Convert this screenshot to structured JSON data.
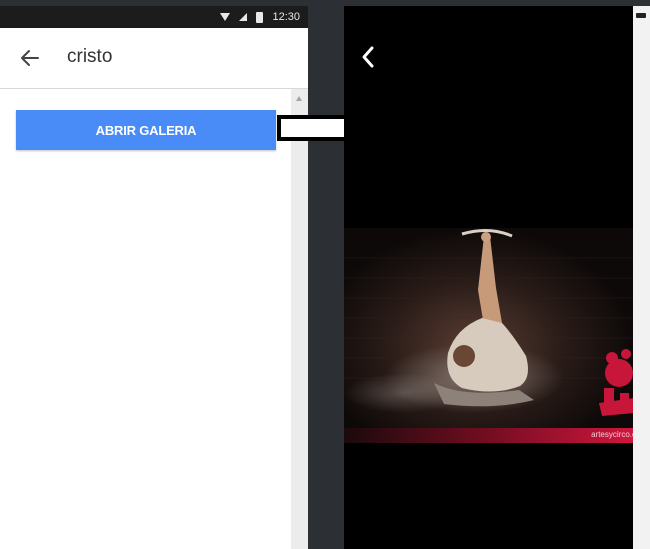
{
  "left_screen": {
    "status_bar": {
      "time": "12:30"
    },
    "app_bar": {
      "title": "cristo"
    },
    "button": {
      "label": "ABRIR GALERIA"
    }
  },
  "right_screen": {
    "photo_watermark": "artesycirco.c"
  },
  "colors": {
    "button_blue": "#4a8cf7",
    "background_dark": "#2c2f34",
    "photo_accent": "#c8153a"
  }
}
